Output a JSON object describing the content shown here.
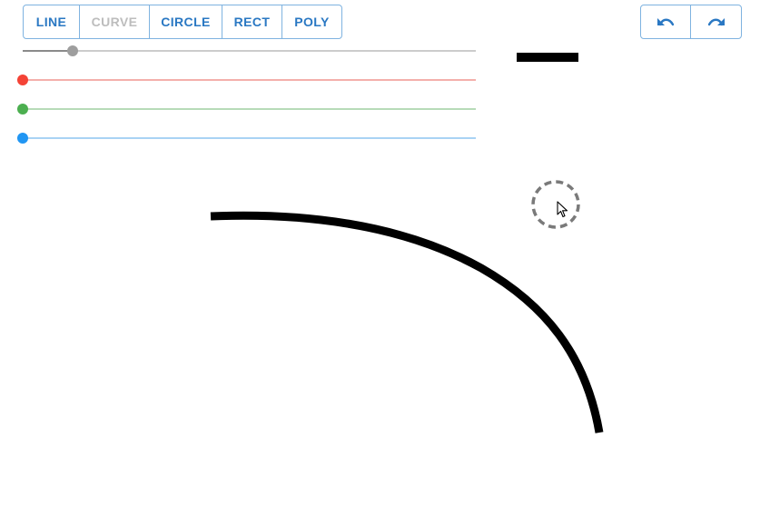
{
  "toolbar": {
    "tools": [
      {
        "label": "LINE",
        "enabled": true
      },
      {
        "label": "CURVE",
        "enabled": false
      },
      {
        "label": "CIRCLE",
        "enabled": true
      },
      {
        "label": "RECT",
        "enabled": true
      },
      {
        "label": "POLY",
        "enabled": true
      }
    ],
    "history": {
      "undo_icon": "undo-icon",
      "redo_icon": "redo-icon"
    }
  },
  "sliders": {
    "stroke_width": {
      "value_fraction": 0.11,
      "color": "#9e9e9e"
    },
    "red": {
      "value": 0,
      "color": "#f44336"
    },
    "green": {
      "value": 0,
      "color": "#4caf50"
    },
    "blue": {
      "value": 0,
      "color": "#2196f3"
    }
  },
  "colors": {
    "accent": "#2a78c3",
    "stroke": "#000000",
    "disabled": "#bdbdbd"
  },
  "canvas": {
    "drawn_shape": "curve",
    "cursor": "brush-ring"
  }
}
